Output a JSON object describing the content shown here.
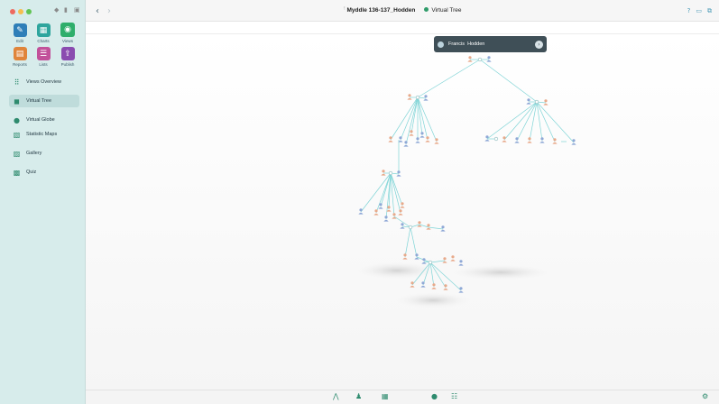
{
  "window": {
    "document_title": "Myddle 136-137_Hodden",
    "view_title": "Virtual Tree"
  },
  "sidebar": {
    "tools": [
      {
        "name": "edit",
        "label": "Edit",
        "color": "#2f7fb8",
        "icon": "pencil-icon"
      },
      {
        "name": "charts",
        "label": "Charts",
        "color": "#2ea59d",
        "icon": "charts-grid-icon"
      },
      {
        "name": "views",
        "label": "Views",
        "color": "#2fae6b",
        "icon": "eye-icon"
      },
      {
        "name": "reports",
        "label": "Reports",
        "color": "#e0853b",
        "icon": "report-icon"
      },
      {
        "name": "lists",
        "label": "Lists",
        "color": "#c2519a",
        "icon": "list-icon"
      },
      {
        "name": "publish",
        "label": "Publish",
        "color": "#8a4cb0",
        "icon": "publish-icon"
      }
    ],
    "nav": [
      {
        "name": "views-overview",
        "label": "Views Overview",
        "icon": "grid-dots-icon",
        "active": false
      },
      {
        "name": "virtual-tree",
        "label": "Virtual Tree",
        "icon": "cube-icon",
        "active": true
      },
      {
        "name": "virtual-globe",
        "label": "Virtual Globe",
        "icon": "globe-icon",
        "active": false
      },
      {
        "name": "statistic-maps",
        "label": "Statistic Maps",
        "icon": "map-icon",
        "active": false
      },
      {
        "name": "gallery",
        "label": "Gallery",
        "icon": "image-icon",
        "active": false
      },
      {
        "name": "quiz",
        "label": "Quiz",
        "icon": "quiz-icon",
        "active": false
      }
    ]
  },
  "popup": {
    "person_name": "Francis  Hodden"
  },
  "colors": {
    "male_node": "#8fa8d6",
    "female_node": "#e8a98a",
    "link": "#7fd4d6",
    "accent": "#2fae6b"
  }
}
